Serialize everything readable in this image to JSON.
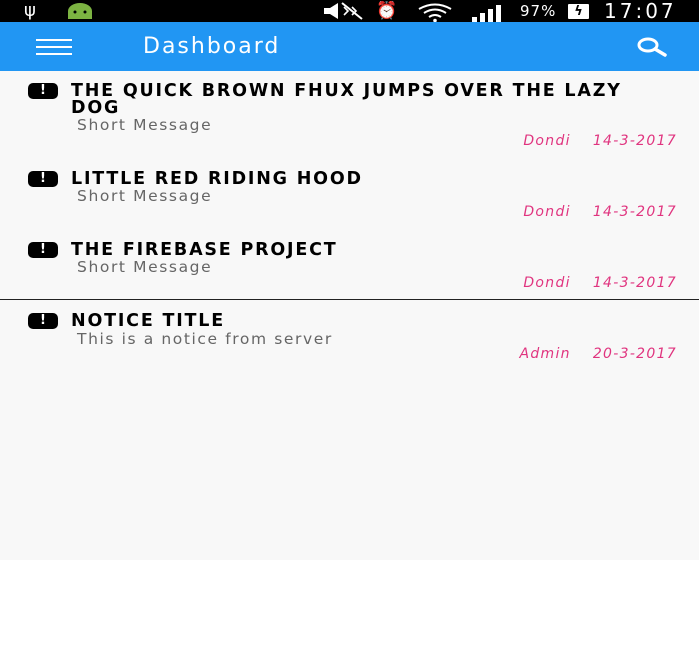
{
  "status_bar": {
    "battery": "97%",
    "time": "17:07"
  },
  "app_bar": {
    "title": "Dashboard",
    "color": "#2196f3"
  },
  "notices": [
    {
      "title": "THE QUICK BROWN FHUX JUMPS OVER THE LAZY DOG",
      "message": "Short Message",
      "author": "Dondi",
      "date": "14-3-2017"
    },
    {
      "title": "LITTLE RED RIDING HOOD",
      "message": "Short Message",
      "author": "Dondi",
      "date": "14-3-2017"
    },
    {
      "title": "THE FIREBASE PROJECT",
      "message": "Short Message",
      "author": "Dondi",
      "date": "14-3-2017"
    },
    {
      "title": "NOTICE TITLE",
      "message": "This is a notice from server",
      "author": "Admin",
      "date": "20-3-2017"
    }
  ],
  "icons": {
    "notice_icon": "alert-icon",
    "menu": "hamburger-menu-icon",
    "search": "search-icon"
  },
  "colors": {
    "accent": "#e0347f"
  }
}
